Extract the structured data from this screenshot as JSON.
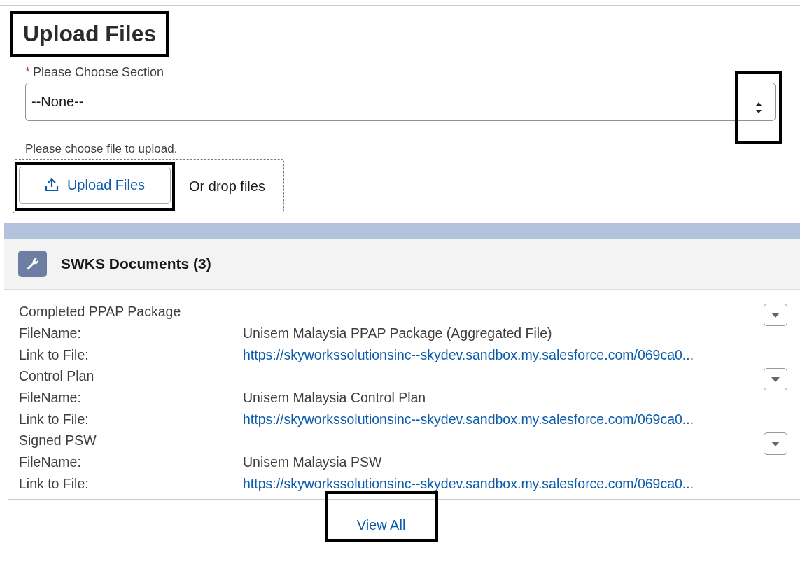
{
  "upload": {
    "title": "Upload Files",
    "title_highlighted": true,
    "section_label": "Please Choose Section",
    "required_mark": "*",
    "section_value": "--None--",
    "arrows_highlighted": true,
    "hint": "Please choose file to upload.",
    "button": "Upload Files",
    "button_highlighted": true,
    "drop_text": "Or drop files"
  },
  "documents": {
    "title": "SWKS Documents (3)",
    "items": [
      {
        "title": "Completed PPAP Package",
        "file_label": "FileName:",
        "file_name": "Unisem Malaysia PPAP Package (Aggregated File)",
        "link_label": "Link to File:",
        "link": "https://skyworkssolutionsinc--skydev.sandbox.my.salesforce.com/069ca0..."
      },
      {
        "title": "Control Plan",
        "file_label": "FileName:",
        "file_name": "Unisem Malaysia Control Plan",
        "link_label": "Link to File:",
        "link": "https://skyworkssolutionsinc--skydev.sandbox.my.salesforce.com/069ca0..."
      },
      {
        "title": "Signed PSW",
        "file_label": "FileName:",
        "file_name": "Unisem Malaysia PSW",
        "link_label": "Link to File:",
        "link": "https://skyworkssolutionsinc--skydev.sandbox.my.salesforce.com/069ca0..."
      }
    ],
    "view_all": "View All",
    "view_all_highlighted": true
  }
}
